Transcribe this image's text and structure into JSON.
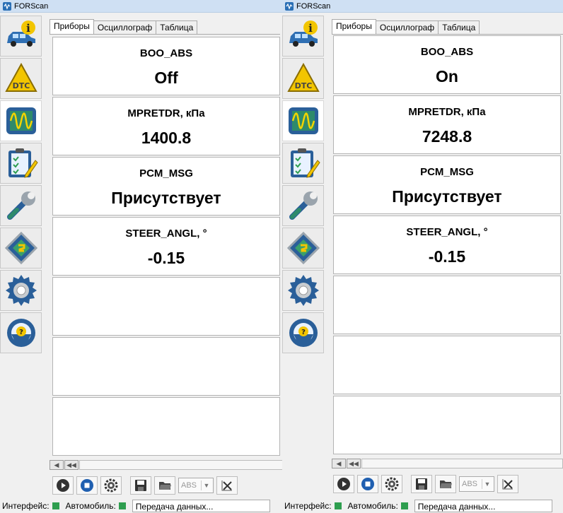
{
  "app_title": "FORScan",
  "sidebar": {
    "items": [
      {
        "name": "vehicle-info",
        "icon": "car-info-icon"
      },
      {
        "name": "dtc",
        "icon": "dtc-warning-icon"
      },
      {
        "name": "oscilloscope",
        "icon": "oscilloscope-icon",
        "active": true
      },
      {
        "name": "tests",
        "icon": "checklist-icon"
      },
      {
        "name": "service",
        "icon": "wrench-icon"
      },
      {
        "name": "configuration",
        "icon": "chip-icon"
      },
      {
        "name": "settings",
        "icon": "gear-icon"
      },
      {
        "name": "help",
        "icon": "help-steering-icon"
      }
    ]
  },
  "tabs": [
    "Приборы",
    "Осциллограф",
    "Таблица"
  ],
  "panes": [
    {
      "gauges": [
        {
          "label": "BOO_ABS",
          "value": "Off"
        },
        {
          "label": "MPRETDR, кПа",
          "value": "1400.8"
        },
        {
          "label": "PCM_MSG",
          "value": "Присутствует"
        },
        {
          "label": "STEER_ANGL, °",
          "value": "-0.15"
        }
      ]
    },
    {
      "gauges": [
        {
          "label": "BOO_ABS",
          "value": "On"
        },
        {
          "label": "MPRETDR, кПа",
          "value": "7248.8"
        },
        {
          "label": "PCM_MSG",
          "value": "Присутствует"
        },
        {
          "label": "STEER_ANGL, °",
          "value": "-0.15"
        }
      ]
    }
  ],
  "toolbar": {
    "select_value": "ABS"
  },
  "status": {
    "interface_label": "Интерфейс:",
    "vehicle_label": "Автомобиль:",
    "message": "Передача данных..."
  },
  "colors": {
    "status_ok": "#2e9e4f",
    "titlebar": "#cfe0f3"
  }
}
